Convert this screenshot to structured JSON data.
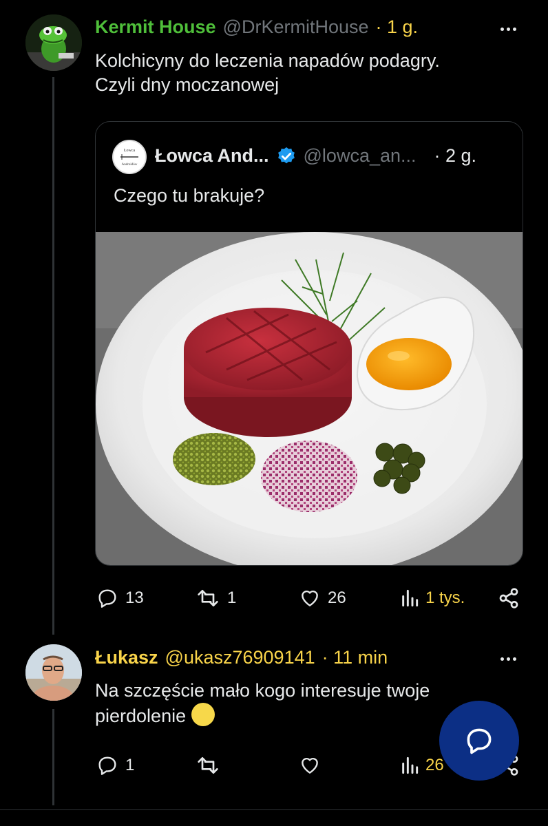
{
  "tweet1": {
    "name": "Kermit House",
    "handle": "@DrKermitHouse",
    "time": "· 1 g.",
    "text_line1": "Kolchicyny do leczenia napadów podagry.",
    "text_line2": "Czyli dny moczanowej",
    "name_color": "#4fbf3a"
  },
  "quote": {
    "name": "Łowca And...",
    "handle": "@lowca_an...",
    "time": "· 2 g.",
    "text": "Czego tu brakuje?",
    "avatar_text": "Łowca Androidów",
    "verified_color": "#1d9bf0"
  },
  "tweet1_actions": {
    "replies": "13",
    "retweets": "1",
    "likes": "26",
    "views": "1 tys.",
    "views_color": "#f9d44a"
  },
  "tweet2": {
    "name": "Łukasz",
    "handle": "@ukasz76909141",
    "time": "· 11 min",
    "text_line1": "Na szczęście mało kogo interesuje twoje",
    "text_line2": "pierdolenie",
    "emoji": "😃",
    "name_color": "#f9d44a"
  },
  "tweet2_actions": {
    "replies": "1",
    "views": "26"
  },
  "icons": {
    "reply": "reply-icon",
    "retweet": "retweet-icon",
    "like": "heart-icon",
    "views": "views-icon",
    "share": "share-icon",
    "more": "more-icon",
    "fab": "compose-reply-icon"
  }
}
